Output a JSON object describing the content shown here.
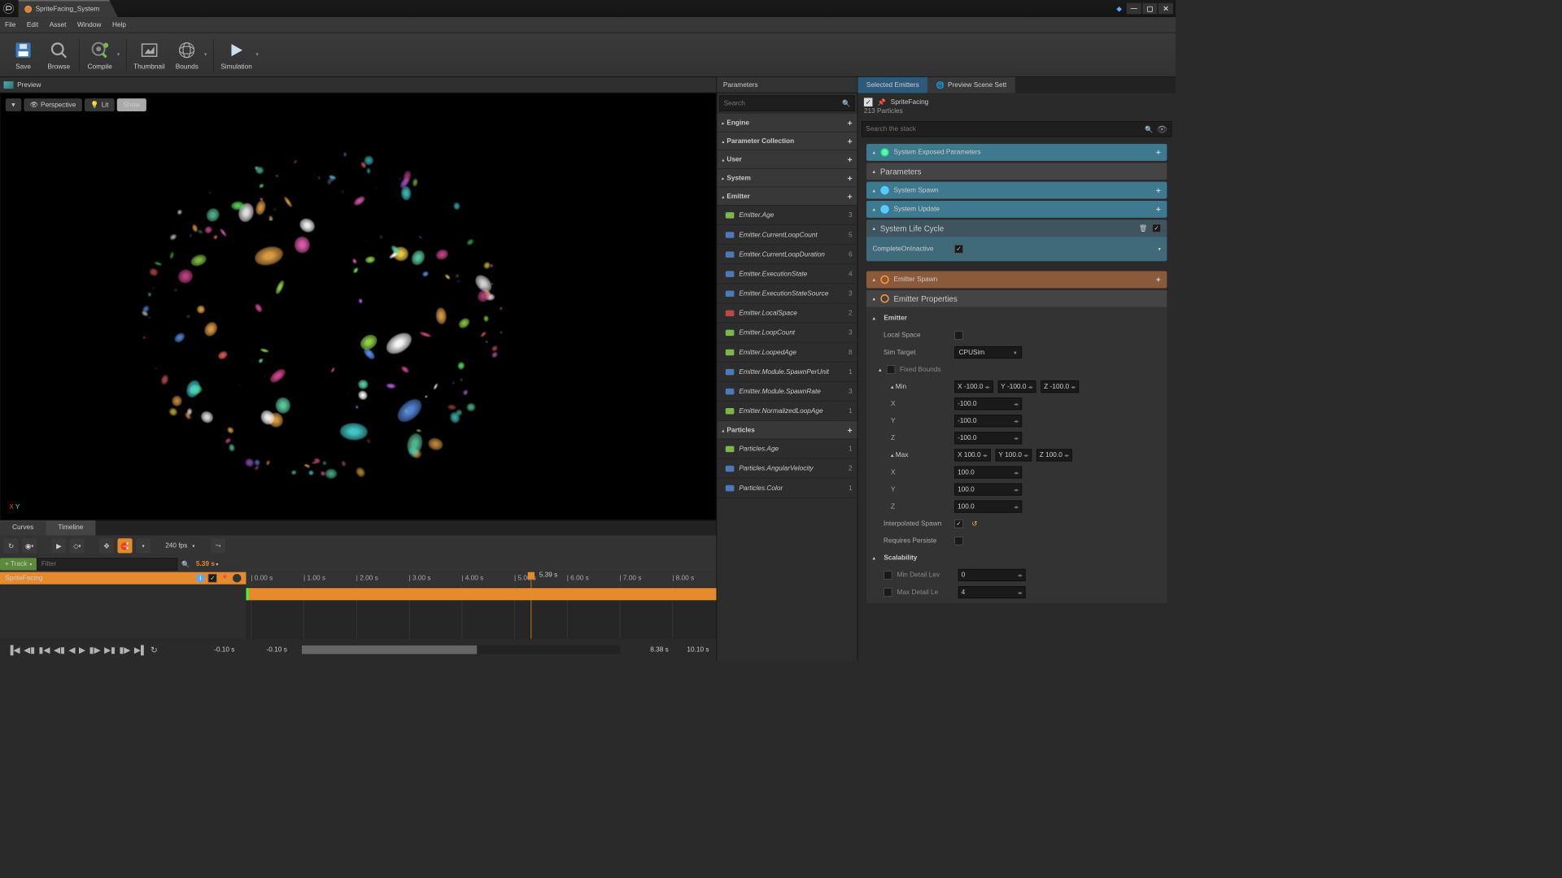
{
  "title": "SpriteFacing_System",
  "menu": [
    "File",
    "Edit",
    "Asset",
    "Window",
    "Help"
  ],
  "toolbar": [
    {
      "name": "save-button",
      "label": "Save",
      "drop": false
    },
    {
      "name": "browse-button",
      "label": "Browse",
      "drop": false
    },
    {
      "name": "compile-button",
      "label": "Compile",
      "drop": true
    },
    {
      "name": "thumbnail-button",
      "label": "Thumbnail",
      "drop": false
    },
    {
      "name": "bounds-button",
      "label": "Bounds",
      "drop": true
    },
    {
      "name": "simulation-button",
      "label": "Simulation",
      "drop": true
    }
  ],
  "preview": {
    "title": "Preview",
    "perspective": "Perspective",
    "lit": "Lit",
    "show": "Show"
  },
  "parameters": {
    "title": "Parameters",
    "search_placeholder": "Search",
    "categories": [
      {
        "name": "Engine",
        "expandable": true
      },
      {
        "name": "Parameter Collection",
        "expandable": false
      },
      {
        "name": "User",
        "expandable": false
      },
      {
        "name": "System",
        "expandable": true
      },
      {
        "name": "Emitter",
        "expanded": true,
        "items": [
          {
            "label": "Emitter.Age",
            "count": 3,
            "color": "#7ab84a"
          },
          {
            "label": "Emitter.CurrentLoopCount",
            "count": 5,
            "color": "#4a7ab8"
          },
          {
            "label": "Emitter.CurrentLoopDuration",
            "count": 6,
            "color": "#4a7ab8"
          },
          {
            "label": "Emitter.ExecutionState",
            "count": 4,
            "color": "#4a7ab8"
          },
          {
            "label": "Emitter.ExecutionStateSource",
            "count": 3,
            "color": "#4a7ab8"
          },
          {
            "label": "Emitter.LocalSpace",
            "count": 2,
            "color": "#b84a4a"
          },
          {
            "label": "Emitter.LoopCount",
            "count": 3,
            "color": "#7ab84a"
          },
          {
            "label": "Emitter.LoopedAge",
            "count": 8,
            "color": "#7ab84a"
          },
          {
            "label": "Emitter.Module.SpawnPerUnit",
            "count": 1,
            "color": "#4a7ab8"
          },
          {
            "label": "Emitter.Module.SpawnRate",
            "count": 3,
            "color": "#4a7ab8"
          },
          {
            "label": "Emitter.NormalizedLoopAge",
            "count": 1,
            "color": "#7ab84a"
          }
        ]
      },
      {
        "name": "Particles",
        "expanded": true,
        "items": [
          {
            "label": "Particles.Age",
            "count": 1,
            "color": "#7ab84a"
          },
          {
            "label": "Particles.AngularVelocity",
            "count": 2,
            "color": "#4a7ab8"
          },
          {
            "label": "Particles.Color",
            "count": 1,
            "color": "#4a7ab8"
          }
        ]
      }
    ]
  },
  "details": {
    "tabs": [
      {
        "label": "Selected Emitters",
        "sel": true
      },
      {
        "label": "Preview Scene Sett",
        "sel": false
      }
    ],
    "system_name": "SpriteFacing",
    "particle_count": "213 Particles",
    "stack_search": "Search the stack",
    "sections": {
      "system_exposed": "System Exposed Parameters",
      "parameters": "Parameters",
      "system_spawn": "System Spawn",
      "system_update": "System Update",
      "system_lifecycle": "System Life Cycle",
      "complete_inactive": "CompleteOnInactive",
      "emitter_spawn": "Emitter Spawn",
      "emitter_properties": "Emitter Properties",
      "emitter_group": "Emitter",
      "local_space": "Local Space",
      "sim_target": "Sim Target",
      "sim_target_val": "CPUSim",
      "fixed_bounds": "Fixed Bounds",
      "min": "Min",
      "max": "Max",
      "x": "X",
      "y": "Y",
      "z": "Z",
      "min_vals": {
        "x": "-100.0",
        "y": "-100.0",
        "z": "-100.0"
      },
      "max_vals": {
        "x": "100.0",
        "y": "100.0",
        "z": "100.0"
      },
      "interp_spawn": "Interpolated Spawn",
      "requires_persist": "Requires Persiste",
      "scalability": "Scalability",
      "min_detail": "Min Detail Lev",
      "min_detail_val": "0",
      "max_detail": "Max Detail Le",
      "max_detail_val": "4"
    }
  },
  "timeline": {
    "tabs": [
      "Curves",
      "Timeline"
    ],
    "fps": "240 fps",
    "add_track": "+ Track",
    "filter": "Filter",
    "current_time": "5.39 s",
    "playhead_label": "5.39 s",
    "ticks": [
      "0.00 s",
      "1.00 s",
      "2.00 s",
      "3.00 s",
      "4.00 s",
      "5.00 s",
      "6.00 s",
      "7.00 s",
      "8.00 s"
    ],
    "track_name": "SpriteFacing",
    "range": {
      "start": "-0.10 s",
      "start2": "-0.10 s",
      "end": "8.38 s",
      "end2": "10.10 s"
    }
  }
}
